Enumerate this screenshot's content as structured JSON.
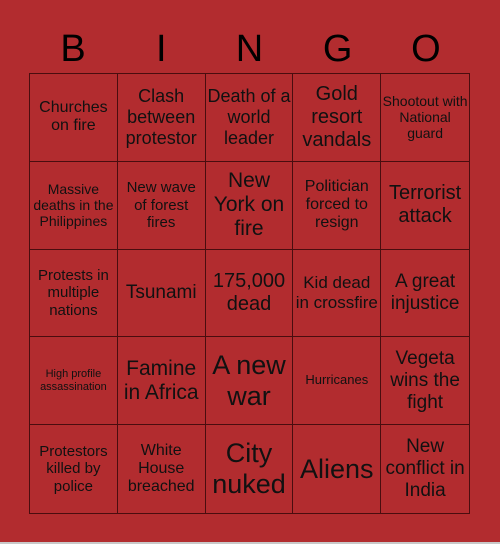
{
  "header": {
    "letters": [
      "B",
      "I",
      "N",
      "G",
      "O"
    ]
  },
  "card": {
    "background_color": "#b22c2f",
    "cells": [
      "Churches on fire",
      "Clash between protestor",
      "Death of a world leader",
      "Gold resort vandals",
      "Shootout with National guard",
      "Massive deaths in the Philippines",
      "New wave of forest fires",
      "New York on fire",
      "Politician forced to resign",
      "Terrorist attack",
      "Protests in multiple nations",
      "Tsunami",
      "175,000 dead",
      "Kid dead in crossfire",
      "A great injustice",
      "High profile assassination",
      "Famine in Africa",
      "A new war",
      "Hurricanes",
      "Vegeta wins the fight",
      "Protestors killed by police",
      "White House breached",
      "City nuked",
      "Aliens",
      "New conflict in India"
    ]
  }
}
